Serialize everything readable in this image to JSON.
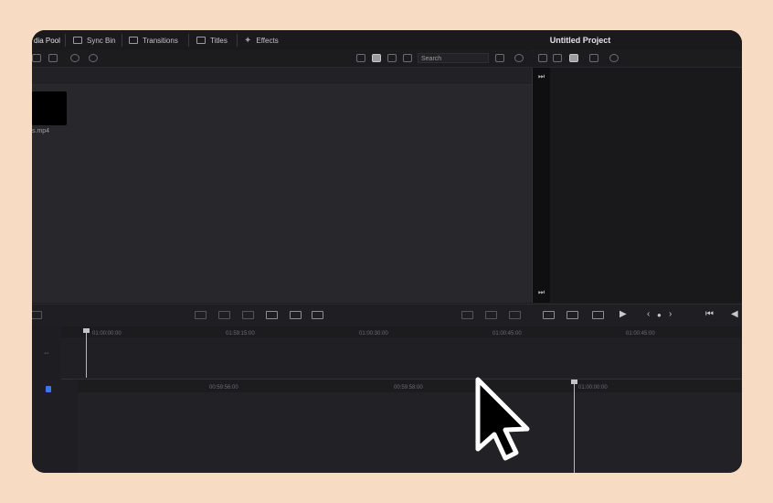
{
  "tabs": [
    {
      "label": "dia Pool",
      "icon": "media-pool-icon"
    },
    {
      "label": "Sync Bin",
      "icon": "sync-bin-icon"
    },
    {
      "label": "Transitions",
      "icon": "transitions-icon"
    },
    {
      "label": "Titles",
      "icon": "titles-icon"
    },
    {
      "label": "Effects",
      "icon": "effects-icon"
    }
  ],
  "project_title": "Untitled Project",
  "search": {
    "placeholder": "Search"
  },
  "clip": {
    "name": "s.mp4"
  },
  "timeline_top": {
    "ticks": [
      "01:00:00:00",
      "01:59:15:00",
      "01:00:30:00",
      "01:00:45:00",
      "01:00:45:00"
    ]
  },
  "timeline_bottom": {
    "ticks": [
      "00:59:56:00",
      "00:59:58:00",
      "01:00:00:00"
    ]
  },
  "transport": {
    "prev": "‹",
    "next": "›"
  },
  "colors": {
    "background": "#f7dcc3",
    "panel": "#28282c",
    "accent_track": "#3b78e7"
  }
}
